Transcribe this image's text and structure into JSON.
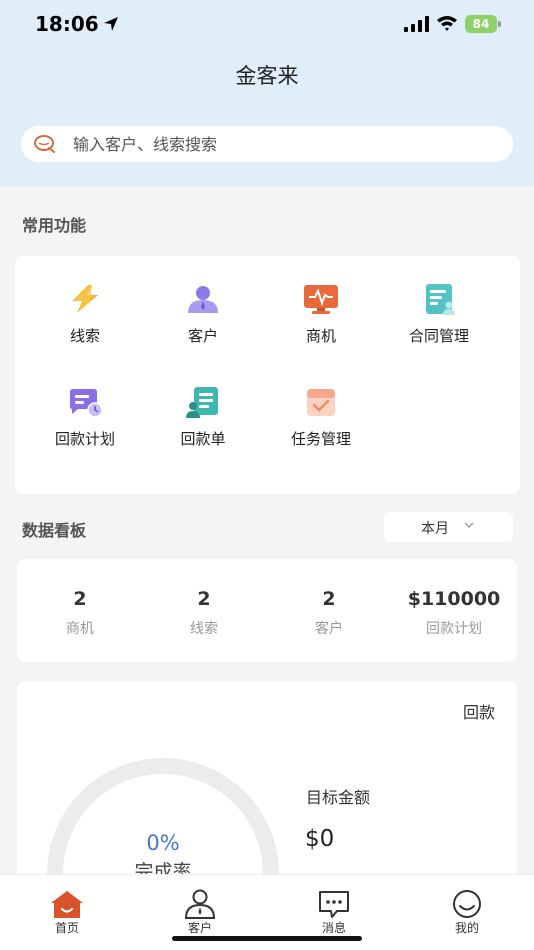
{
  "status": {
    "time": "18:06",
    "battery": "84"
  },
  "header": {
    "title": "金客来"
  },
  "search": {
    "placeholder": "输入客户、线索搜索"
  },
  "sections": {
    "common": "常用功能",
    "dashboard": "数据看板"
  },
  "functions": [
    {
      "label": "线索",
      "icon": "lightning-icon"
    },
    {
      "label": "客户",
      "icon": "person-icon"
    },
    {
      "label": "商机",
      "icon": "monitor-pulse-icon"
    },
    {
      "label": "合同管理",
      "icon": "document-user-icon"
    },
    {
      "label": "回款计划",
      "icon": "chat-clock-icon"
    },
    {
      "label": "回款单",
      "icon": "receipt-user-icon"
    },
    {
      "label": "任务管理",
      "icon": "task-check-icon"
    }
  ],
  "period": {
    "selected": "本月"
  },
  "stats": [
    {
      "value": "2",
      "label": "商机"
    },
    {
      "value": "2",
      "label": "线索"
    },
    {
      "value": "2",
      "label": "客户"
    },
    {
      "value": "$110000",
      "label": "回款计划"
    }
  ],
  "payment": {
    "title": "回款",
    "completion_value": "0%",
    "completion_label": "完成率",
    "target_label": "目标金额",
    "target_value": "$0"
  },
  "tabs": [
    {
      "label": "首页",
      "icon": "home-icon"
    },
    {
      "label": "客户",
      "icon": "user-icon"
    },
    {
      "label": "消息",
      "icon": "message-icon"
    },
    {
      "label": "我的",
      "icon": "smile-icon"
    }
  ]
}
